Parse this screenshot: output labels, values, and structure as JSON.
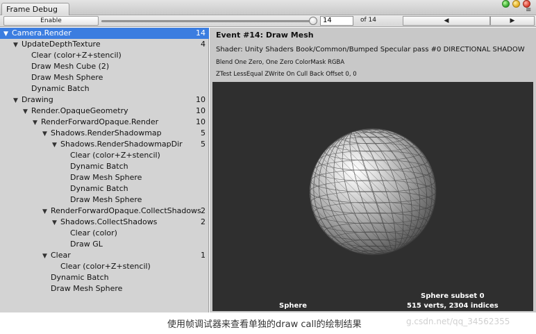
{
  "window": {
    "tab_title": "Frame Debug"
  },
  "toolbar": {
    "enable_label": "Enable",
    "event_value": "14",
    "of_label": "of 14",
    "prev_icon": "triangle-left-icon",
    "next_icon": "triangle-right-icon",
    "slider_level": 1.0
  },
  "tree": [
    {
      "label": "Camera.Render",
      "count": "14",
      "depth": 0,
      "expanded": true,
      "selected": true
    },
    {
      "label": "UpdateDepthTexture",
      "count": "4",
      "depth": 1,
      "expanded": true
    },
    {
      "label": "Clear (color+Z+stencil)",
      "count": "",
      "depth": 2
    },
    {
      "label": "Draw Mesh Cube (2)",
      "count": "",
      "depth": 2
    },
    {
      "label": "Draw Mesh Sphere",
      "count": "",
      "depth": 2
    },
    {
      "label": "Dynamic Batch",
      "count": "",
      "depth": 2
    },
    {
      "label": "Drawing",
      "count": "10",
      "depth": 1,
      "expanded": true
    },
    {
      "label": "Render.OpaqueGeometry",
      "count": "10",
      "depth": 2,
      "expanded": true
    },
    {
      "label": "RenderForwardOpaque.Render",
      "count": "10",
      "depth": 3,
      "expanded": true
    },
    {
      "label": "Shadows.RenderShadowmap",
      "count": "5",
      "depth": 4,
      "expanded": true
    },
    {
      "label": "Shadows.RenderShadowmapDir",
      "count": "5",
      "depth": 5,
      "expanded": true
    },
    {
      "label": "Clear (color+Z+stencil)",
      "count": "",
      "depth": 6
    },
    {
      "label": "Dynamic Batch",
      "count": "",
      "depth": 6
    },
    {
      "label": "Draw Mesh Sphere",
      "count": "",
      "depth": 6
    },
    {
      "label": "Dynamic Batch",
      "count": "",
      "depth": 6
    },
    {
      "label": "Draw Mesh Sphere",
      "count": "",
      "depth": 6
    },
    {
      "label": "RenderForwardOpaque.CollectShadows",
      "count": "2",
      "depth": 4,
      "expanded": true
    },
    {
      "label": "Shadows.CollectShadows",
      "count": "2",
      "depth": 5,
      "expanded": true
    },
    {
      "label": "Clear (color)",
      "count": "",
      "depth": 6
    },
    {
      "label": "Draw GL",
      "count": "",
      "depth": 6
    },
    {
      "label": "Clear",
      "count": "1",
      "depth": 4,
      "expanded": true
    },
    {
      "label": "Clear (color+Z+stencil)",
      "count": "",
      "depth": 5
    },
    {
      "label": "Dynamic Batch",
      "count": "",
      "depth": 4
    },
    {
      "label": "Draw Mesh Sphere",
      "count": "",
      "depth": 4
    }
  ],
  "details": {
    "event_title": "Event #14: Draw Mesh",
    "shader_line": "Shader: Unity Shaders Book/Common/Bumped Specular pass #0   DIRECTIONAL SHADOW",
    "blend_line": "Blend One Zero, One Zero ColorMask RGBA",
    "ztest_line": "ZTest LessEqual ZWrite On Cull Back Offset 0, 0",
    "mesh_name": "Sphere",
    "subset_label": "Sphere subset 0",
    "stats_label": "515 verts, 2304 indices"
  },
  "caption": "使用帧调试器来查看单独的draw call的绘制结果",
  "watermark": "g.csdn.net/qq_34562355",
  "colors": {
    "selection": "#3b7de0",
    "tree_bg": "#d3d3d3",
    "viewport_bg": "#2f2f2f"
  }
}
